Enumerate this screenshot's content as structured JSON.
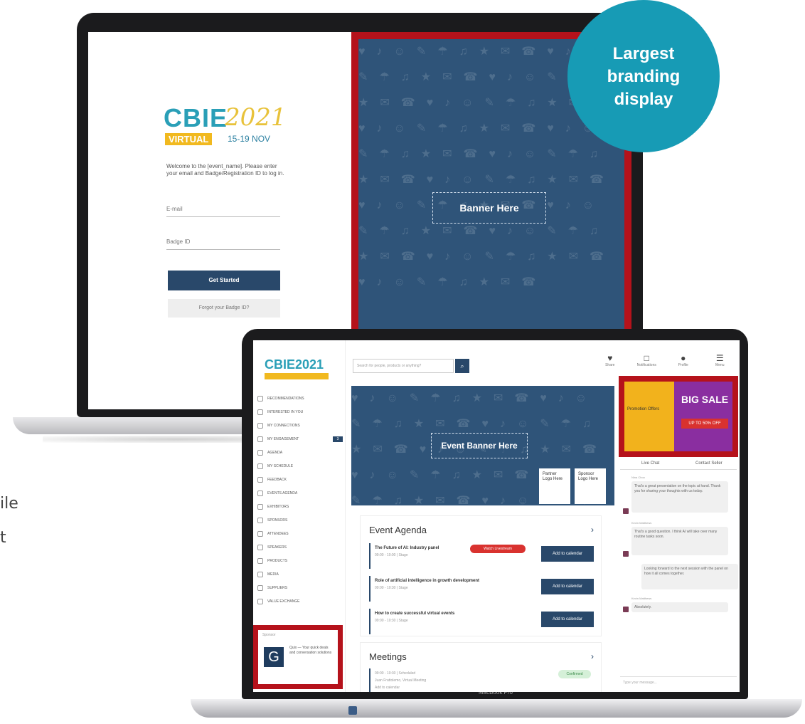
{
  "edge_text": {
    "line1": "ile",
    "line2": "t"
  },
  "back_laptop": {
    "logo": {
      "name": "CBIE",
      "year": "2021",
      "virtual": "VIRTUAL",
      "dates": "15-19 NOV"
    },
    "welcome": "Welcome to the [event_name]. Please enter your email and Badge/Registration ID to log in.",
    "email_label": "E-mail",
    "badge_label": "Badge ID",
    "start_button": "Get Started",
    "forgot_button": "Forgot your Badge ID?",
    "banner_label": "Banner Here"
  },
  "callout": {
    "line1": "Largest",
    "line2": "branding",
    "line3": "display"
  },
  "front_laptop": {
    "model_label": "MacBook Pro",
    "logo": "CBIE2021",
    "nav": [
      {
        "label": "RECOMMENDATIONS",
        "badge": ""
      },
      {
        "label": "INTERESTED IN YOU",
        "badge": ""
      },
      {
        "label": "MY CONNECTIONS",
        "badge": ""
      },
      {
        "label": "MY ENGAGEMENT",
        "badge": "3"
      },
      {
        "label": "AGENDA",
        "badge": ""
      },
      {
        "label": "MY SCHEDULE",
        "badge": ""
      },
      {
        "label": "FEEDBACK",
        "badge": ""
      },
      {
        "label": "EVENTS AGENDA",
        "badge": ""
      },
      {
        "label": "EXHIBITORS",
        "badge": ""
      },
      {
        "label": "SPONSORS",
        "badge": ""
      },
      {
        "label": "ATTENDEES",
        "badge": ""
      },
      {
        "label": "SPEAKERS",
        "badge": ""
      },
      {
        "label": "PRODUCTS",
        "badge": ""
      },
      {
        "label": "MEDIA",
        "badge": ""
      },
      {
        "label": "SUPPLIERS",
        "badge": ""
      },
      {
        "label": "VALUE EXCHANGE",
        "badge": ""
      }
    ],
    "sponsor": {
      "label": "Sponsor",
      "letter": "G",
      "text": "Quix — Your quick deals and conversation solutions"
    },
    "search_placeholder": "Search for people, products or anything?",
    "top_icons": [
      {
        "glyph": "♥",
        "label": "Share"
      },
      {
        "glyph": "□",
        "label": "Notifications"
      },
      {
        "glyph": "●",
        "label": "Profile"
      },
      {
        "glyph": "☰",
        "label": "Menu"
      }
    ],
    "event_banner_label": "Event Banner Here",
    "partner_logo": "Partner Logo Here",
    "sponsor_logo": "Sponsor Logo Here",
    "agenda": {
      "title": "Event Agenda",
      "rows": [
        {
          "title": "The Future of AI: Industry panel",
          "time": "09:00 - 10:00 | Stage",
          "button": "Add to calendar",
          "pill": "Watch Livestream"
        },
        {
          "title": "Role of artificial intelligence in growth development",
          "time": "09:00 - 10:30 | Stage",
          "button": "Add to calendar",
          "pill": ""
        },
        {
          "title": "How to create successful virtual events",
          "time": "09:00 - 10:30 | Stage",
          "button": "Add to calendar",
          "pill": ""
        }
      ]
    },
    "meetings": {
      "title": "Meetings",
      "time": "09:00 - 10:30 | Scheduled",
      "with": "Juan Frattolemo, Virtual Meeting",
      "status": "Confirmed",
      "action": "Add to calendar"
    },
    "ad": {
      "left": "Promotion Offers",
      "big": "BIG SALE",
      "off": "UP TO 50% OFF"
    },
    "chat": {
      "tab_live": "Live Chat",
      "tab_contact": "Contact Seller",
      "messages": [
        {
          "name": "Nina Choo",
          "text": "That's a great presentation on the topic at hand. Thank you for sharing your thoughts with us today."
        },
        {
          "name": "Kevin Matthews",
          "text": "That's a good question. I think AI will take over many routine tasks soon."
        },
        {
          "name": "",
          "text": "Looking forward to the next session with the panel on how it all comes together."
        },
        {
          "name": "Kevin Matthews",
          "text": "Absolutely."
        }
      ],
      "input_placeholder": "Type your message..."
    }
  }
}
